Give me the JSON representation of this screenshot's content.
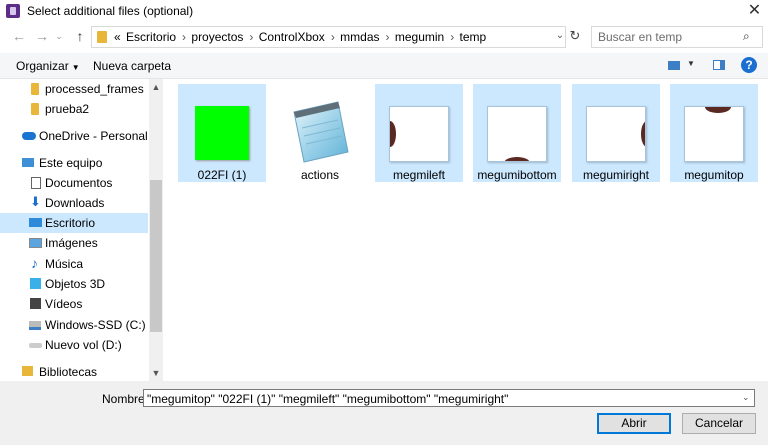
{
  "window": {
    "title": "Select additional files (optional)",
    "close_glyph": "✕"
  },
  "nav": {
    "back": "←",
    "forward": "→",
    "up": "↑"
  },
  "address": {
    "crumbs": [
      "«",
      "Escritorio",
      "proyectos",
      "ControlXbox",
      "mmdas",
      "megumin",
      "temp"
    ],
    "separator": "›"
  },
  "search": {
    "placeholder": "Buscar en temp",
    "icon": "search-icon"
  },
  "toolbar": {
    "organize": "Organizar",
    "new_folder": "Nueva carpeta",
    "help": "?"
  },
  "sidebar": {
    "items": [
      {
        "label": "processed_frames",
        "icon": "folder-icon"
      },
      {
        "label": "prueba2",
        "icon": "folder-icon"
      },
      {
        "label": "OneDrive - Personal",
        "icon": "cloud-icon"
      },
      {
        "label": "Este equipo",
        "icon": "computer-icon"
      },
      {
        "label": "Documentos",
        "icon": "document-icon"
      },
      {
        "label": "Downloads",
        "icon": "download-icon"
      },
      {
        "label": "Escritorio",
        "icon": "desktop-icon",
        "selected": true
      },
      {
        "label": "Imágenes",
        "icon": "pictures-icon"
      },
      {
        "label": "Música",
        "icon": "music-icon"
      },
      {
        "label": "Objetos 3D",
        "icon": "objects-3d-icon"
      },
      {
        "label": "Vídeos",
        "icon": "videos-icon"
      },
      {
        "label": "Windows-SSD (C:)",
        "icon": "drive-icon"
      },
      {
        "label": "Nuevo vol (D:)",
        "icon": "drive-icon"
      },
      {
        "label": "Bibliotecas",
        "icon": "library-icon"
      }
    ]
  },
  "files": [
    {
      "name": "022FI (1)",
      "selected": true,
      "thumb": "green"
    },
    {
      "name": "actions",
      "selected": false,
      "thumb": "notepad"
    },
    {
      "name": "megmileft",
      "selected": true,
      "thumb": "left-arc"
    },
    {
      "name": "megumibottom",
      "selected": true,
      "thumb": "bottom-arc"
    },
    {
      "name": "megumiright",
      "selected": true,
      "thumb": "right-arc"
    },
    {
      "name": "megumitop",
      "selected": true,
      "thumb": "top-arc"
    }
  ],
  "footer": {
    "name_label": "Nombre:",
    "name_value": "\"megumitop\" \"022FI (1)\" \"megmileft\" \"megumibottom\" \"megumiright\"",
    "open": "Abrir",
    "cancel": "Cancelar"
  },
  "colors": {
    "selection": "#cce8ff",
    "accent": "#0078d7",
    "green_thumb": "#00ff00"
  }
}
